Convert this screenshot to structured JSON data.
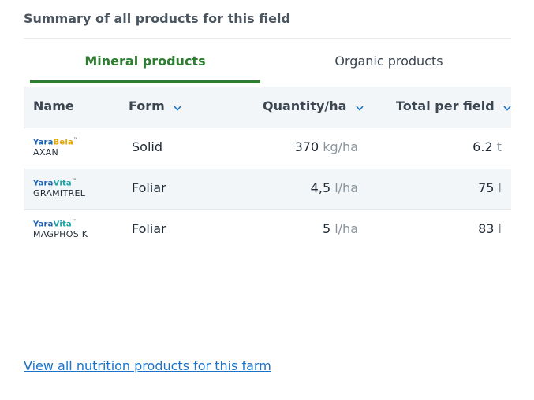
{
  "title": "Summary of all products for this field",
  "tabs": [
    {
      "label": "Mineral products",
      "active": true
    },
    {
      "label": "Organic products",
      "active": false
    }
  ],
  "columns": {
    "name": "Name",
    "form": "Form",
    "quantity": "Quantity/ha",
    "total": "Total per field"
  },
  "rows": [
    {
      "brand_main": "Yara",
      "brand_sub": "Bela",
      "product": "AXAN",
      "form": "Solid",
      "qty": "370",
      "qty_unit": "kg/ha",
      "total": "6.2",
      "total_unit": "t"
    },
    {
      "brand_main": "Yara",
      "brand_sub": "Vita",
      "product": "GRAMITREL",
      "form": "Foliar",
      "qty": "4,5",
      "qty_unit": "l/ha",
      "total": "75",
      "total_unit": "l"
    },
    {
      "brand_main": "Yara",
      "brand_sub": "Vita",
      "product": "MAGPHOS K",
      "form": "Foliar",
      "qty": "5",
      "qty_unit": "l/ha",
      "total": "83",
      "total_unit": "l"
    }
  ],
  "footer_link": "View all nutrition products for this farm",
  "colors": {
    "accent": "#2e7d32",
    "link": "#1a73c9",
    "row_alt": "#f2f6f8"
  }
}
